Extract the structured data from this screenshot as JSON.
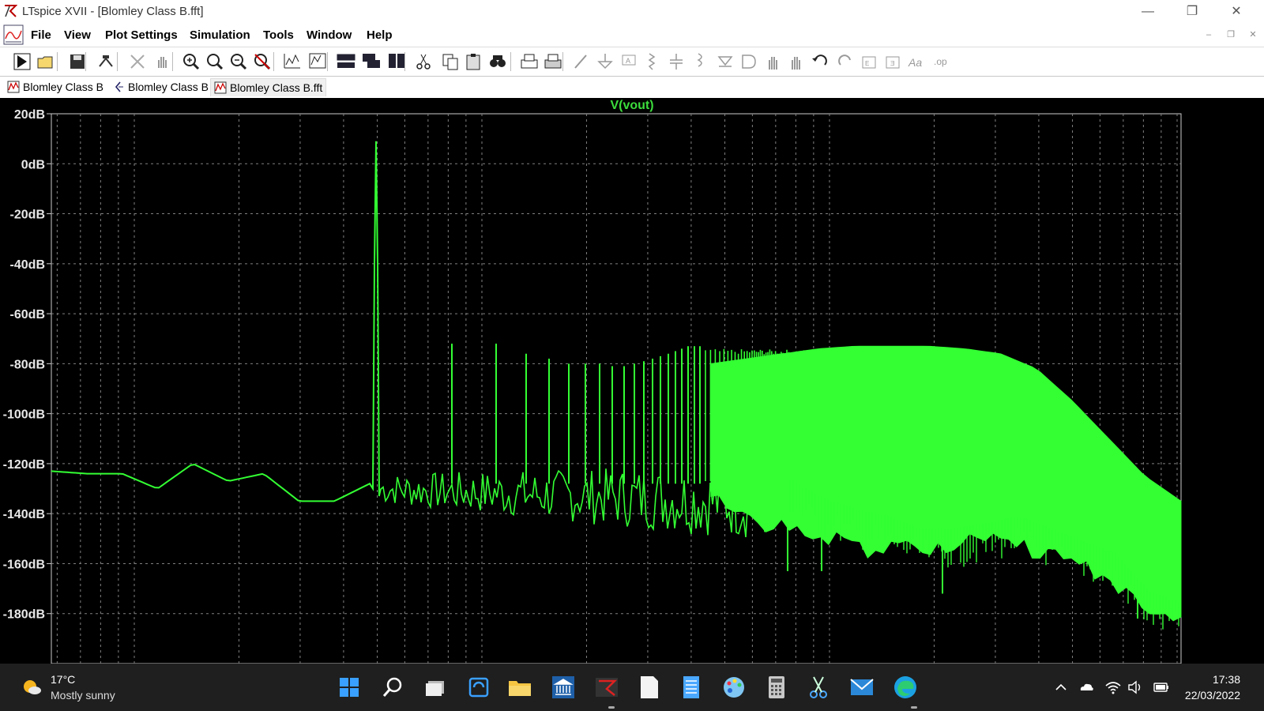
{
  "window": {
    "title": "LTspice XVII - [Blomley Class B.fft]",
    "controls": [
      "minimize",
      "restore",
      "close"
    ]
  },
  "menu": {
    "file": "File",
    "view": "View",
    "plot_settings": "Plot Settings",
    "simulation": "Simulation",
    "tools": "Tools",
    "window": "Window",
    "help": "Help"
  },
  "toolbar": {
    "buttons": [
      "run",
      "open",
      "save",
      "control-panel",
      "halt",
      "pan",
      "zoom-in",
      "zoom-fit",
      "zoom-out",
      "zoom-cancel",
      "autorange",
      "fft-settings",
      "tile-horizontal",
      "cascade",
      "tile-vertical",
      "cut",
      "copy",
      "paste",
      "find",
      "print",
      "print-setup",
      "wire",
      "ground",
      "label",
      "resistor",
      "capacitor",
      "inductor",
      "diode",
      "component",
      "move",
      "drag",
      "undo",
      "redo",
      "rotate",
      "mirror",
      "text",
      "spice-directive"
    ]
  },
  "tabs": [
    {
      "label": "Blomley Class B",
      "icon": "waveform-icon"
    },
    {
      "label": "Blomley Class B",
      "icon": "schematic-icon"
    },
    {
      "label": "Blomley Class B.fft",
      "icon": "fft-icon",
      "active": true
    }
  ],
  "plot": {
    "trace_name": "V(vout)",
    "background": "#000000",
    "trace_color": "#33ff33",
    "grid_color": "#808080"
  },
  "chart_data": {
    "type": "line",
    "title": "V(vout)",
    "xlabel": "",
    "ylabel": "",
    "ylim": [
      -200,
      20
    ],
    "yticks": [
      "20dB",
      "0dB",
      "-20dB",
      "-40dB",
      "-60dB",
      "-80dB",
      "-100dB",
      "-120dB",
      "-140dB",
      "-160dB",
      "-180dB"
    ],
    "x_scale": "log",
    "grid": true,
    "series": [
      {
        "fundamental_db": 9,
        "noise_floor_db": [
          -123,
          -124,
          -124,
          -130,
          -120,
          -127,
          -124,
          -135,
          -135,
          -128,
          -142,
          -129,
          -122,
          -131,
          -134,
          -128,
          -146
        ],
        "harmonic_peaks_db": [
          -72,
          -72,
          -76,
          -78,
          -80,
          -80,
          -80,
          -81,
          -81,
          -80,
          -79,
          -78,
          -77,
          -76,
          -75,
          -74,
          -73,
          -73,
          -73
        ],
        "envelope_top_db": [
          -80,
          -78,
          -76,
          -74,
          -73,
          -73,
          -73,
          -74,
          -76,
          -82,
          -95,
          -110,
          -125,
          -135
        ],
        "envelope_bottom_db": [
          -130,
          -138,
          -142,
          -145,
          -150,
          -150,
          -148,
          -145,
          -150,
          -155,
          -160,
          -175,
          -180
        ]
      }
    ]
  },
  "taskbar": {
    "weather_temp": "17°C",
    "weather_condition": "Mostly sunny",
    "apps": [
      "windows-start",
      "search",
      "task-view",
      "widgets",
      "file-explorer",
      "bank-app",
      "ltspice",
      "notepad",
      "notes",
      "paint",
      "calculator",
      "snipping-tool",
      "mail",
      "edge"
    ],
    "time": "17:38",
    "date": "22/03/2022"
  }
}
